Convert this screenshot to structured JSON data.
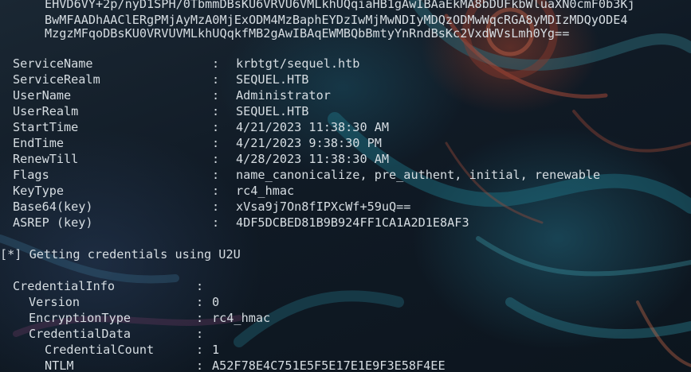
{
  "blob_lines": [
    "EHVD6VY+2p/nyD1SPH/0TbmmDBsKU6VRVU6VMLkhUQqiaHB1gAwIBAaEkMA8bDUFkbWluaXN0cmF0b3Kj",
    "BwMFAADhAAClERgPMjAyMzA0MjExODM4MzBaphEYDzIwMjMwNDIyMDQzODMwWqcRGA8yMDIzMDQyODE4",
    "MzgzMFqoDBsKU0VRVUVMLkhUQqkfMB2gAwIBAqEWMBQbBmtyYnRndBsKc2VxdWVsLmh0Yg=="
  ],
  "ticket": [
    {
      "key": "ServiceName",
      "sep": ":",
      "value": "krbtgt/sequel.htb"
    },
    {
      "key": "ServiceRealm",
      "sep": ":",
      "value": "SEQUEL.HTB"
    },
    {
      "key": "UserName",
      "sep": ":",
      "value": "Administrator"
    },
    {
      "key": "UserRealm",
      "sep": ":",
      "value": "SEQUEL.HTB"
    },
    {
      "key": "StartTime",
      "sep": ":",
      "value": "4/21/2023 11:38:30 AM"
    },
    {
      "key": "EndTime",
      "sep": ":",
      "value": "4/21/2023 9:38:30 PM"
    },
    {
      "key": "RenewTill",
      "sep": ":",
      "value": "4/28/2023 11:38:30 AM"
    },
    {
      "key": "Flags",
      "sep": ":",
      "value": "name_canonicalize, pre_authent, initial, renewable"
    },
    {
      "key": "KeyType",
      "sep": ":",
      "value": "rc4_hmac"
    },
    {
      "key": "Base64(key)",
      "sep": ":",
      "value": "xVsa9j7On8fIPXcWf+59uQ=="
    },
    {
      "key": "ASREP (key)",
      "sep": ":",
      "value": "4DF5DCBED81B9B924FF1CA1A2D1E8AF3"
    }
  ],
  "u2u_message": "[*] Getting credentials using U2U",
  "credential_info": {
    "key": "CredentialInfo",
    "sep": ":"
  },
  "cred_fields": [
    {
      "key": "Version",
      "sep": ":",
      "value": "0"
    },
    {
      "key": "EncryptionType",
      "sep": ":",
      "value": "rc4_hmac"
    },
    {
      "key": "CredentialData",
      "sep": ":",
      "value": ""
    }
  ],
  "cred_data_fields": [
    {
      "key": "CredentialCount",
      "sep": ":",
      "value": "1"
    },
    {
      "key": "NTLM",
      "sep": ":",
      "value": "A52F78E4C751E5F5E17E1E9F3E58F4EE"
    }
  ],
  "colors": {
    "text": "#d6dde2",
    "background": "#0f1a24"
  }
}
